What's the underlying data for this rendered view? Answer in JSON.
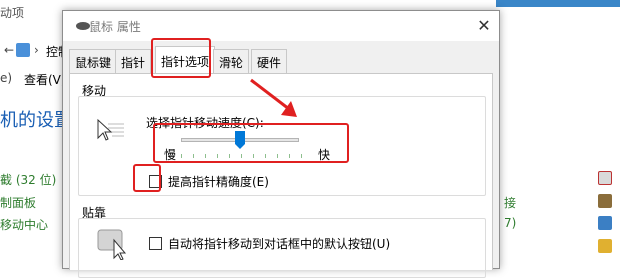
{
  "background": {
    "top_left": "动项",
    "address_fragment": "控制",
    "view_menu": "查看(V)",
    "page_title_fragment": "机的设置",
    "items": [
      {
        "text": "截 (32 位)"
      },
      {
        "text": "制面板"
      },
      {
        "text": "移动中心"
      }
    ],
    "right_fragments": [
      "接",
      "7)"
    ]
  },
  "dialog": {
    "title": "鼠标 属性",
    "close_symbol": "✕",
    "tabs": [
      {
        "label": "鼠标键"
      },
      {
        "label": "指针"
      },
      {
        "label": "指针选项"
      },
      {
        "label": "滑轮"
      },
      {
        "label": "硬件"
      }
    ],
    "motion_group": {
      "title": "移动",
      "speed_label": "选择指针移动速度(C):",
      "slow_label": "慢",
      "fast_label": "快",
      "speed_value_fraction": 0.5,
      "precision_label": "提高指针精确度(E)",
      "precision_checked": false
    },
    "snap_group": {
      "title": "贴靠",
      "snap_label": "自动将指针移动到对话框中的默认按钮(U)",
      "snap_checked": false
    }
  },
  "colors": {
    "highlight": "#e02020",
    "slider_thumb": "#0078d7",
    "link_blue": "#1a5fb4",
    "link_green": "#2f7d2f"
  }
}
